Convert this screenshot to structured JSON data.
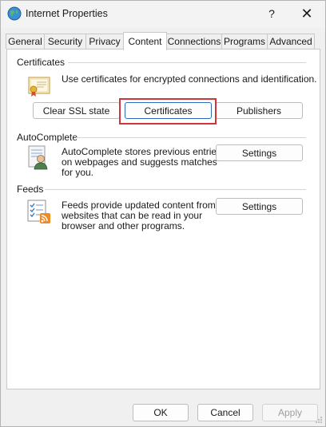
{
  "window": {
    "title": "Internet Properties"
  },
  "titlebar": {
    "help_glyph": "?",
    "close_glyph": "✕"
  },
  "tabs": [
    {
      "label": "General"
    },
    {
      "label": "Security"
    },
    {
      "label": "Privacy"
    },
    {
      "label": "Content",
      "active": true
    },
    {
      "label": "Connections"
    },
    {
      "label": "Programs"
    },
    {
      "label": "Advanced"
    }
  ],
  "certificates": {
    "heading": "Certificates",
    "description": "Use certificates for encrypted connections and identification.",
    "buttons": {
      "clear_ssl": "Clear SSL state",
      "certificates": "Certificates",
      "publishers": "Publishers"
    },
    "icon": "certificate-icon"
  },
  "autocomplete": {
    "heading": "AutoComplete",
    "description_lines": [
      "AutoComplete stores previous entries",
      "on webpages and suggests matches",
      "for you."
    ],
    "settings_label": "Settings",
    "icon": "autocomplete-user-icon"
  },
  "feeds": {
    "heading": "Feeds",
    "description_lines": [
      "Feeds provide updated content from",
      "websites that can be read in your",
      "browser and other programs."
    ],
    "settings_label": "Settings",
    "icon": "feeds-rss-icon"
  },
  "footer": {
    "ok": "OK",
    "cancel": "Cancel",
    "apply": "Apply"
  },
  "colors": {
    "highlight": "#d1343a",
    "focus_border": "#2c6dba",
    "rss_orange": "#f08a24"
  }
}
